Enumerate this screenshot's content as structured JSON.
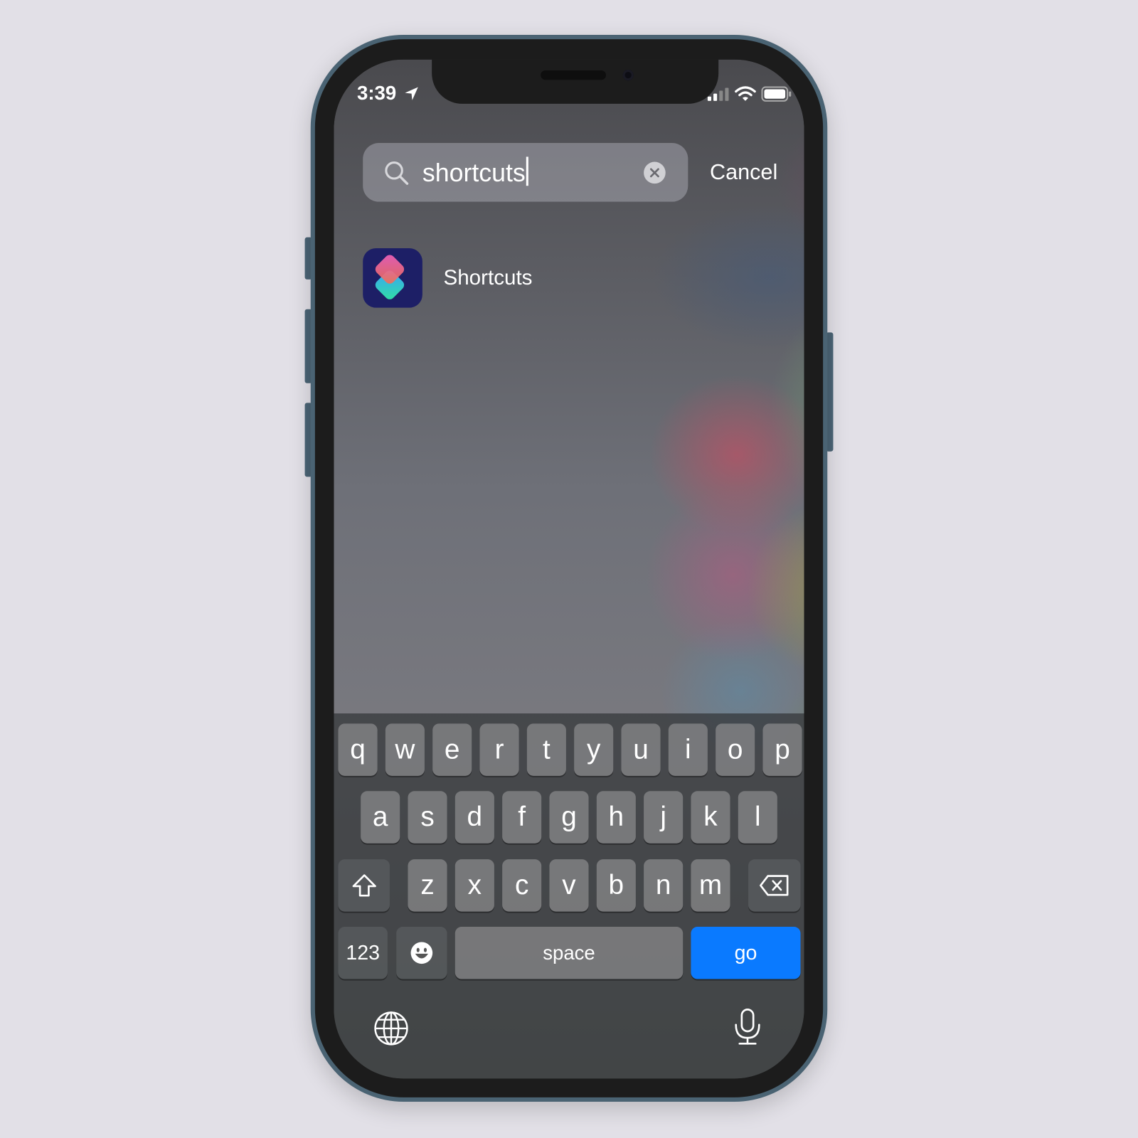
{
  "status_bar": {
    "time": "3:39",
    "location_icon": "location-arrow-icon",
    "signal_icon": "cellular-signal-icon",
    "wifi_icon": "wifi-icon",
    "battery_icon": "battery-icon"
  },
  "search": {
    "query": "shortcuts",
    "search_icon": "magnifier-icon",
    "clear_icon": "clear-x-icon",
    "cancel_label": "Cancel"
  },
  "results": [
    {
      "label": "Shortcuts",
      "icon": "shortcuts-app-icon"
    }
  ],
  "keyboard": {
    "row1": [
      "q",
      "w",
      "e",
      "r",
      "t",
      "y",
      "u",
      "i",
      "o",
      "p"
    ],
    "row2": [
      "a",
      "s",
      "d",
      "f",
      "g",
      "h",
      "j",
      "k",
      "l"
    ],
    "row3": [
      "z",
      "x",
      "c",
      "v",
      "b",
      "n",
      "m"
    ],
    "numbers_label": "123",
    "space_label": "space",
    "go_label": "go",
    "accent_color": "#0a7aff"
  }
}
